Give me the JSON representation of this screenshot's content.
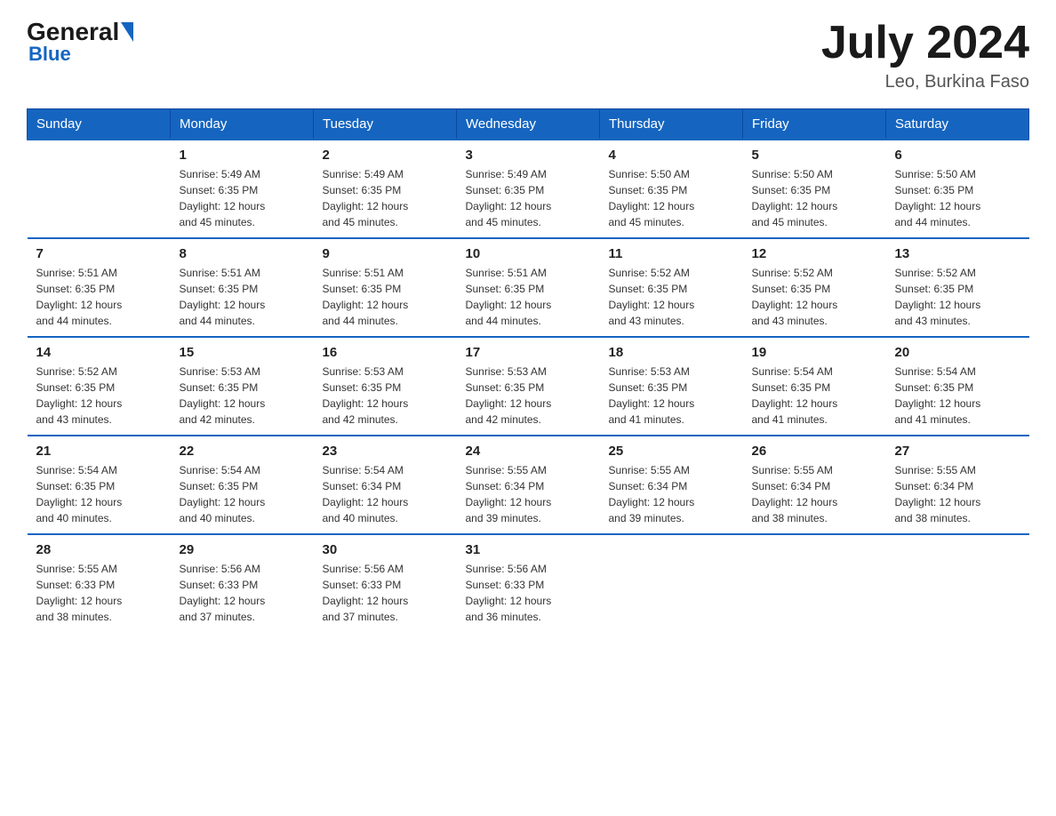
{
  "header": {
    "logo_general": "General",
    "logo_blue": "Blue",
    "title": "July 2024",
    "subtitle": "Leo, Burkina Faso"
  },
  "days_of_week": [
    "Sunday",
    "Monday",
    "Tuesday",
    "Wednesday",
    "Thursday",
    "Friday",
    "Saturday"
  ],
  "weeks": [
    [
      {
        "day": "",
        "info": ""
      },
      {
        "day": "1",
        "info": "Sunrise: 5:49 AM\nSunset: 6:35 PM\nDaylight: 12 hours\nand 45 minutes."
      },
      {
        "day": "2",
        "info": "Sunrise: 5:49 AM\nSunset: 6:35 PM\nDaylight: 12 hours\nand 45 minutes."
      },
      {
        "day": "3",
        "info": "Sunrise: 5:49 AM\nSunset: 6:35 PM\nDaylight: 12 hours\nand 45 minutes."
      },
      {
        "day": "4",
        "info": "Sunrise: 5:50 AM\nSunset: 6:35 PM\nDaylight: 12 hours\nand 45 minutes."
      },
      {
        "day": "5",
        "info": "Sunrise: 5:50 AM\nSunset: 6:35 PM\nDaylight: 12 hours\nand 45 minutes."
      },
      {
        "day": "6",
        "info": "Sunrise: 5:50 AM\nSunset: 6:35 PM\nDaylight: 12 hours\nand 44 minutes."
      }
    ],
    [
      {
        "day": "7",
        "info": "Sunrise: 5:51 AM\nSunset: 6:35 PM\nDaylight: 12 hours\nand 44 minutes."
      },
      {
        "day": "8",
        "info": "Sunrise: 5:51 AM\nSunset: 6:35 PM\nDaylight: 12 hours\nand 44 minutes."
      },
      {
        "day": "9",
        "info": "Sunrise: 5:51 AM\nSunset: 6:35 PM\nDaylight: 12 hours\nand 44 minutes."
      },
      {
        "day": "10",
        "info": "Sunrise: 5:51 AM\nSunset: 6:35 PM\nDaylight: 12 hours\nand 44 minutes."
      },
      {
        "day": "11",
        "info": "Sunrise: 5:52 AM\nSunset: 6:35 PM\nDaylight: 12 hours\nand 43 minutes."
      },
      {
        "day": "12",
        "info": "Sunrise: 5:52 AM\nSunset: 6:35 PM\nDaylight: 12 hours\nand 43 minutes."
      },
      {
        "day": "13",
        "info": "Sunrise: 5:52 AM\nSunset: 6:35 PM\nDaylight: 12 hours\nand 43 minutes."
      }
    ],
    [
      {
        "day": "14",
        "info": "Sunrise: 5:52 AM\nSunset: 6:35 PM\nDaylight: 12 hours\nand 43 minutes."
      },
      {
        "day": "15",
        "info": "Sunrise: 5:53 AM\nSunset: 6:35 PM\nDaylight: 12 hours\nand 42 minutes."
      },
      {
        "day": "16",
        "info": "Sunrise: 5:53 AM\nSunset: 6:35 PM\nDaylight: 12 hours\nand 42 minutes."
      },
      {
        "day": "17",
        "info": "Sunrise: 5:53 AM\nSunset: 6:35 PM\nDaylight: 12 hours\nand 42 minutes."
      },
      {
        "day": "18",
        "info": "Sunrise: 5:53 AM\nSunset: 6:35 PM\nDaylight: 12 hours\nand 41 minutes."
      },
      {
        "day": "19",
        "info": "Sunrise: 5:54 AM\nSunset: 6:35 PM\nDaylight: 12 hours\nand 41 minutes."
      },
      {
        "day": "20",
        "info": "Sunrise: 5:54 AM\nSunset: 6:35 PM\nDaylight: 12 hours\nand 41 minutes."
      }
    ],
    [
      {
        "day": "21",
        "info": "Sunrise: 5:54 AM\nSunset: 6:35 PM\nDaylight: 12 hours\nand 40 minutes."
      },
      {
        "day": "22",
        "info": "Sunrise: 5:54 AM\nSunset: 6:35 PM\nDaylight: 12 hours\nand 40 minutes."
      },
      {
        "day": "23",
        "info": "Sunrise: 5:54 AM\nSunset: 6:34 PM\nDaylight: 12 hours\nand 40 minutes."
      },
      {
        "day": "24",
        "info": "Sunrise: 5:55 AM\nSunset: 6:34 PM\nDaylight: 12 hours\nand 39 minutes."
      },
      {
        "day": "25",
        "info": "Sunrise: 5:55 AM\nSunset: 6:34 PM\nDaylight: 12 hours\nand 39 minutes."
      },
      {
        "day": "26",
        "info": "Sunrise: 5:55 AM\nSunset: 6:34 PM\nDaylight: 12 hours\nand 38 minutes."
      },
      {
        "day": "27",
        "info": "Sunrise: 5:55 AM\nSunset: 6:34 PM\nDaylight: 12 hours\nand 38 minutes."
      }
    ],
    [
      {
        "day": "28",
        "info": "Sunrise: 5:55 AM\nSunset: 6:33 PM\nDaylight: 12 hours\nand 38 minutes."
      },
      {
        "day": "29",
        "info": "Sunrise: 5:56 AM\nSunset: 6:33 PM\nDaylight: 12 hours\nand 37 minutes."
      },
      {
        "day": "30",
        "info": "Sunrise: 5:56 AM\nSunset: 6:33 PM\nDaylight: 12 hours\nand 37 minutes."
      },
      {
        "day": "31",
        "info": "Sunrise: 5:56 AM\nSunset: 6:33 PM\nDaylight: 12 hours\nand 36 minutes."
      },
      {
        "day": "",
        "info": ""
      },
      {
        "day": "",
        "info": ""
      },
      {
        "day": "",
        "info": ""
      }
    ]
  ]
}
